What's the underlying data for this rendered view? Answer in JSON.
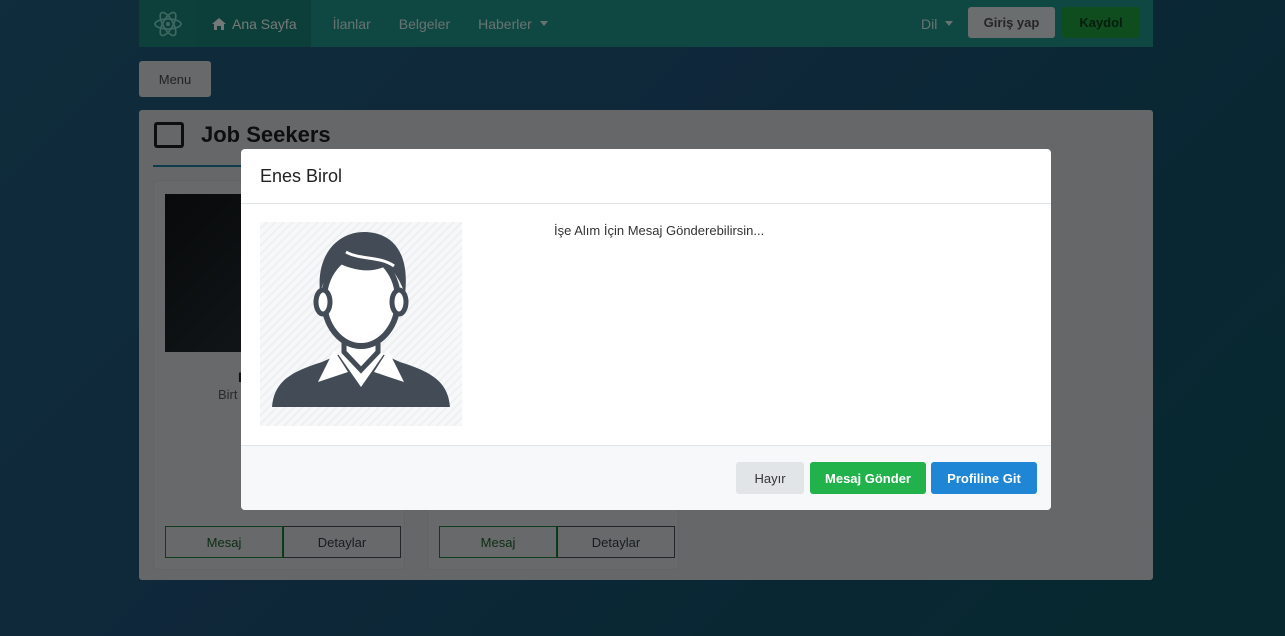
{
  "navbar": {
    "logo_icon": "atom-icon",
    "home_icon": "home-icon",
    "items": [
      {
        "label": "Ana Sayfa"
      },
      {
        "label": "İlanlar"
      },
      {
        "label": "Belgeler"
      },
      {
        "label": "Haberler"
      }
    ],
    "language_label": "Dil",
    "login_label": "Giriş yap",
    "register_label": "Kaydol"
  },
  "menu_button_label": "Menu",
  "panel": {
    "title": "Job Seekers",
    "title_icon": "list-icon",
    "cards": [
      {
        "name_partial": "E",
        "subtitle_partial": "Birt",
        "message_label": "Mesaj",
        "details_label": "Detaylar"
      },
      {
        "message_label": "Mesaj",
        "details_label": "Detaylar"
      }
    ]
  },
  "modal": {
    "title": "Enes Birol",
    "avatar_icon": "user-avatar-icon",
    "message_text": "İşe Alım İçin Mesaj Gönderebilirsin...",
    "buttons": {
      "no": "Hayır",
      "send": "Mesaj Gönder",
      "profile": "Profiline Git"
    }
  },
  "colors": {
    "navbar": "#1f8f84",
    "send_button": "#21b24b",
    "profile_button": "#1e86d5",
    "no_button": "#e2e5e8"
  }
}
